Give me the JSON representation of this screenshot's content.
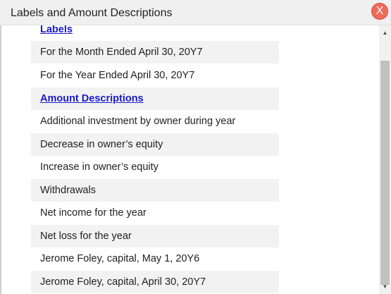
{
  "dialog": {
    "title": "Labels and Amount Descriptions",
    "close_label": "X"
  },
  "items": [
    {
      "text": "Labels",
      "type": "header"
    },
    {
      "text": "For the Month Ended April 30, 20Y7",
      "type": "option"
    },
    {
      "text": "For the Year Ended April 30, 20Y7",
      "type": "option"
    },
    {
      "text": "Amount Descriptions",
      "type": "header"
    },
    {
      "text": "Additional investment by owner during year",
      "type": "option"
    },
    {
      "text": "Decrease in owner’s equity",
      "type": "option"
    },
    {
      "text": "Increase in owner’s equity",
      "type": "option"
    },
    {
      "text": "Withdrawals",
      "type": "option"
    },
    {
      "text": "Net income for the year",
      "type": "option"
    },
    {
      "text": "Net loss for the year",
      "type": "option"
    },
    {
      "text": "Jerome Foley, capital, May 1, 20Y6",
      "type": "option"
    },
    {
      "text": "Jerome Foley, capital, April 30, 20Y7",
      "type": "option"
    }
  ],
  "scrollbar": {
    "up_icon": "triangle-up-icon",
    "down_icon": "triangle-down-icon"
  },
  "colors": {
    "close_button": "#f06a5a",
    "header_link": "#1a1acc",
    "row_shade": "#f2f2f2"
  }
}
